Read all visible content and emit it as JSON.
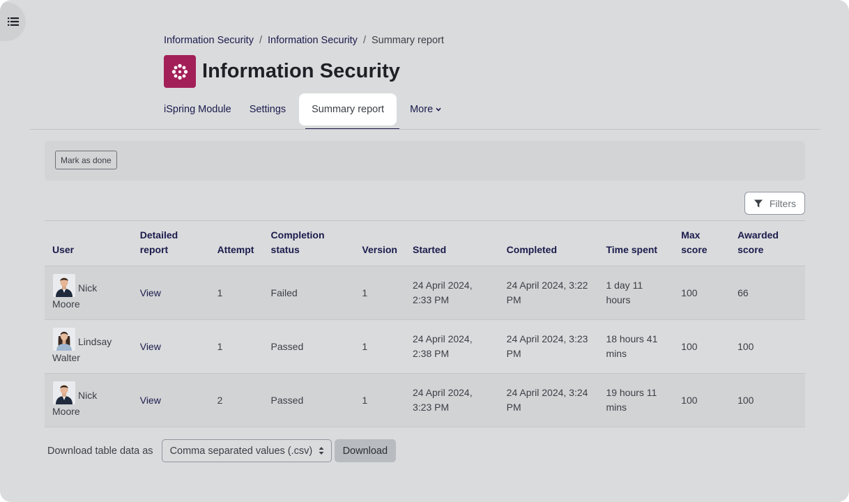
{
  "breadcrumb": [
    {
      "label": "Information Security"
    },
    {
      "label": "Information Security"
    },
    {
      "label": "Summary report"
    }
  ],
  "breadcrumb_separator": "/",
  "page": {
    "title": "Information Security"
  },
  "tabs": [
    {
      "label": "iSpring Module"
    },
    {
      "label": "Settings"
    },
    {
      "label": "Summary report"
    },
    {
      "label": "More"
    }
  ],
  "activity": {
    "mark_done_label": "Mark as done"
  },
  "filters": {
    "label": "Filters"
  },
  "table": {
    "headers": [
      "User",
      "Detailed report",
      "Attempt",
      "Completion status",
      "Version",
      "Started",
      "Completed",
      "Time spent",
      "Max score",
      "Awarded score"
    ],
    "rows": [
      {
        "user_first": "Nick",
        "user_last": "Moore",
        "report": "View",
        "attempt": "1",
        "status": "Failed",
        "version": "1",
        "started": "24 April 2024, 2:33 PM",
        "completed": "24 April 2024, 3:22 PM",
        "time": "1 day 11 hours",
        "max": "100",
        "awarded": "66"
      },
      {
        "user_first": "Lindsay",
        "user_last": "Walter",
        "report": "View",
        "attempt": "1",
        "status": "Passed",
        "version": "1",
        "started": "24 April 2024, 2:38 PM",
        "completed": "24 April 2024, 3:23 PM",
        "time": "18 hours 41 mins",
        "max": "100",
        "awarded": "100"
      },
      {
        "user_first": "Nick",
        "user_last": "Moore",
        "report": "View",
        "attempt": "2",
        "status": "Passed",
        "version": "1",
        "started": "24 April 2024, 3:23 PM",
        "completed": "24 April 2024, 3:24 PM",
        "time": "19 hours 11 mins",
        "max": "100",
        "awarded": "100"
      }
    ]
  },
  "download": {
    "label": "Download table data as",
    "selected_format": "Comma separated values (.csv)",
    "button_label": "Download"
  },
  "colors": {
    "module_icon": "#a31f58",
    "link": "#1a1b4b",
    "frame": "#dadbdd"
  }
}
